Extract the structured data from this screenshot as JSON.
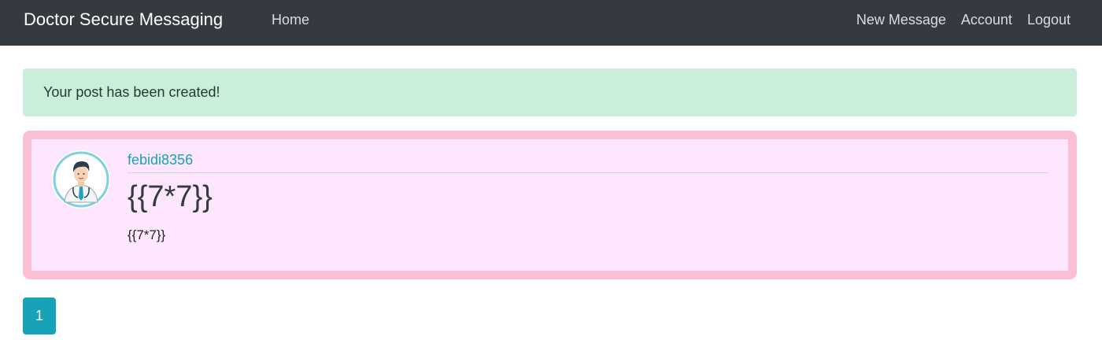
{
  "navbar": {
    "brand": "Doctor Secure Messaging",
    "home": "Home",
    "right_links": [
      "New Message",
      "Account",
      "Logout"
    ]
  },
  "alert": {
    "message": "Your post has been created!"
  },
  "post": {
    "author": "febidi8356",
    "title": "{{7*7}}",
    "body": "{{7*7}}",
    "avatar_icon": "doctor-avatar-icon"
  },
  "pagination": {
    "current_page": "1"
  },
  "colors": {
    "navbar_bg": "#343a40",
    "alert_bg": "#cbeedb",
    "post_bg": "#fde6fe",
    "post_border": "#fbbfd4",
    "accent": "#17a2b8"
  }
}
